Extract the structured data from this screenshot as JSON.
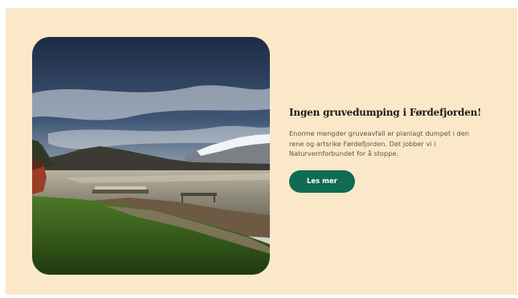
{
  "article": {
    "image_alt": "Fjord med brygge og snødekte fjell",
    "title": "Ingen gruvedumping i Førdefjorden!",
    "description": "Enorme mengder gruveavfall er planlagt dumpet i den rene og artsrike Førdefjorden. Det jobber vi i Naturvernforbundet for å stoppe.",
    "cta_label": "Les mer"
  },
  "colors": {
    "card_background": "#fbe8c8",
    "button_background": "#0f6b54",
    "title_color": "#1c1a17",
    "text_color": "#5c5650"
  }
}
